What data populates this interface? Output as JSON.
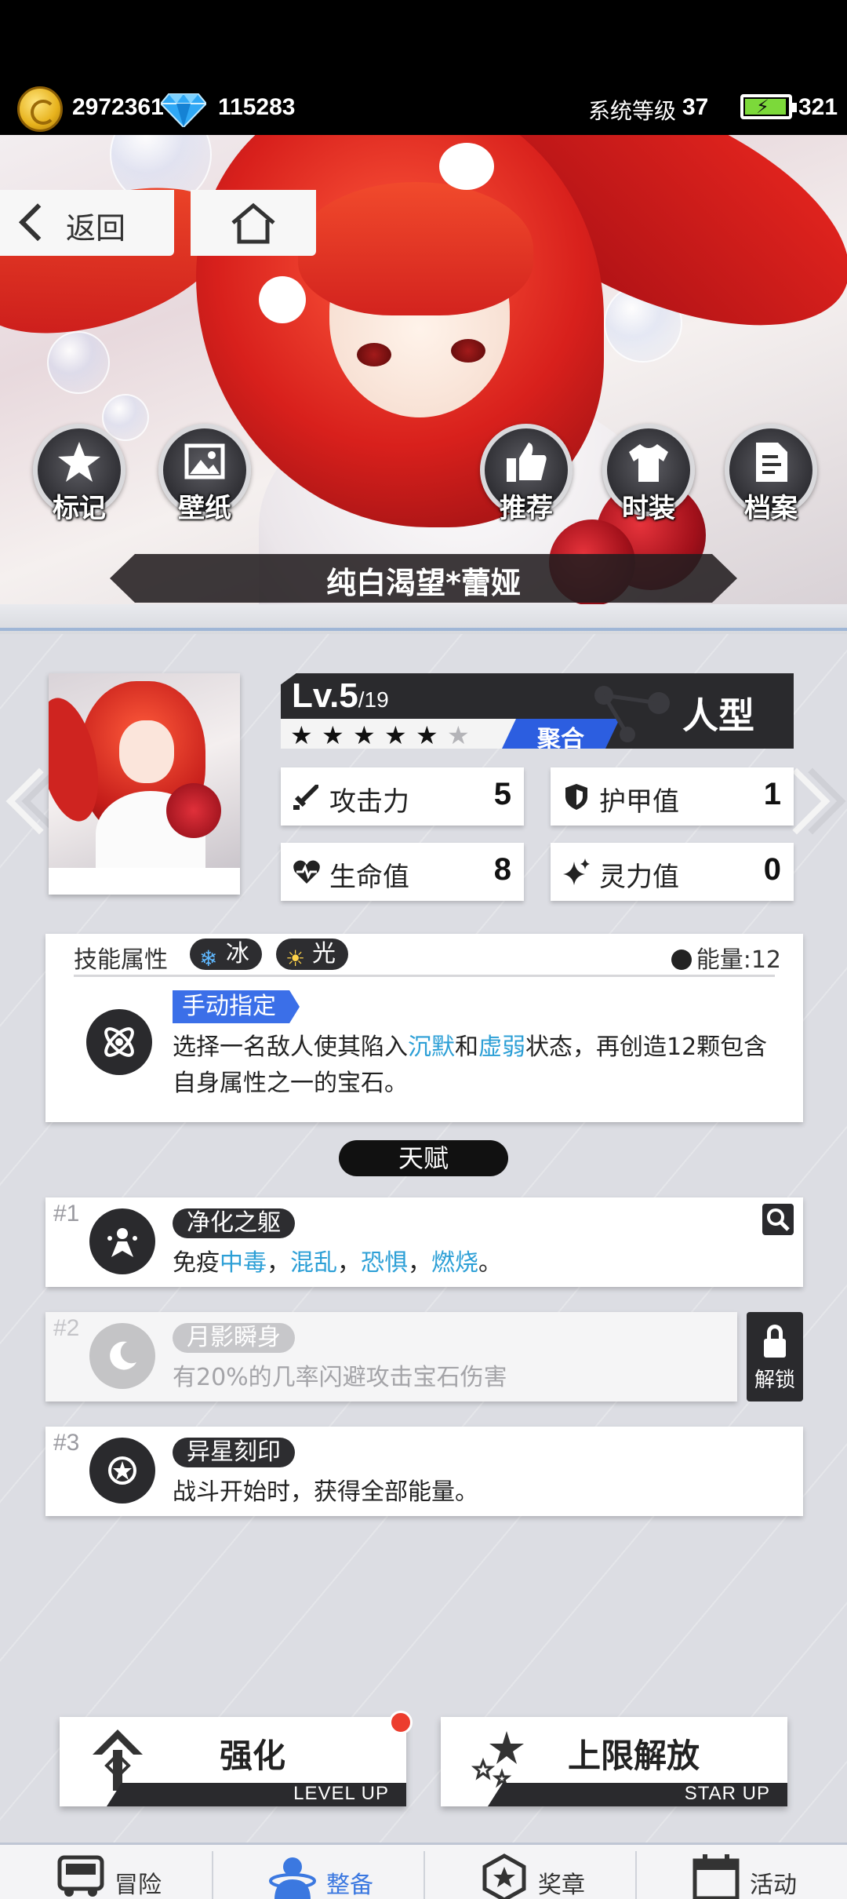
{
  "status": {
    "gold": "2972361",
    "diamonds": "115283",
    "system_level_label": "系统等级",
    "system_level": "37",
    "stamina": "321"
  },
  "nav": {
    "back_label": "返回"
  },
  "hero": {
    "actions_left": [
      {
        "label": "标记",
        "icon": "star-icon"
      },
      {
        "label": "壁纸",
        "icon": "image-icon"
      }
    ],
    "actions_right": [
      {
        "label": "推荐",
        "icon": "thumbs-up-icon"
      },
      {
        "label": "时装",
        "icon": "shirt-icon"
      },
      {
        "label": "档案",
        "icon": "file-icon"
      }
    ],
    "character_name": "纯白渴望*蕾娅"
  },
  "character": {
    "level": "Lv.5",
    "level_max": "/19",
    "stars_filled": 5,
    "stars_total": 6,
    "class_tag": "聚合",
    "type": "人型",
    "stats": [
      {
        "label": "攻击力",
        "value": "5",
        "icon": "sword-icon"
      },
      {
        "label": "护甲值",
        "value": "1",
        "icon": "shield-icon"
      },
      {
        "label": "生命值",
        "value": "8",
        "icon": "heart-icon"
      },
      {
        "label": "灵力值",
        "value": "0",
        "icon": "sparkle-icon"
      }
    ]
  },
  "skill": {
    "header": "技能属性",
    "elements": [
      {
        "label": "冰",
        "icon": "snowflake-icon"
      },
      {
        "label": "光",
        "icon": "sun-icon"
      }
    ],
    "energy": "能量:12",
    "tag": "手动指定",
    "desc_parts": [
      "选择一名敌人使其陷入",
      "沉默",
      "和",
      "虚弱",
      "状态，再创造12颗包含自身属性之一的宝石。"
    ]
  },
  "talents": {
    "title": "天赋",
    "items": [
      {
        "num": "#1",
        "name": "净化之躯",
        "desc_parts": [
          "免疫",
          "中毒",
          "，",
          "混乱",
          "，",
          "恐惧",
          "，",
          "燃烧",
          "。"
        ],
        "locked": false
      },
      {
        "num": "#2",
        "name": "月影瞬身",
        "desc": "有20%的几率闪避攻击宝石伤害",
        "locked": true
      },
      {
        "num": "#3",
        "name": "异星刻印",
        "desc": "战斗开始时，获得全部能量。",
        "locked": false
      }
    ],
    "unlock_label": "解锁"
  },
  "actions": {
    "level_up": {
      "label": "强化",
      "sub": "LEVEL UP"
    },
    "star_up": {
      "label": "上限解放",
      "sub": "STAR UP"
    }
  },
  "bottom_nav": [
    {
      "label": "冒险",
      "icon": "vehicle-icon"
    },
    {
      "label": "整备",
      "icon": "character-icon",
      "active": true
    },
    {
      "label": "奖章",
      "icon": "medal-icon"
    },
    {
      "label": "活动",
      "icon": "calendar-icon"
    }
  ],
  "colors": {
    "accent_blue": "#3b6fe8",
    "highlight_cyan": "#2c9fd6",
    "notify_red": "#ec3d2e",
    "panel_dark": "#2a2a2d"
  }
}
